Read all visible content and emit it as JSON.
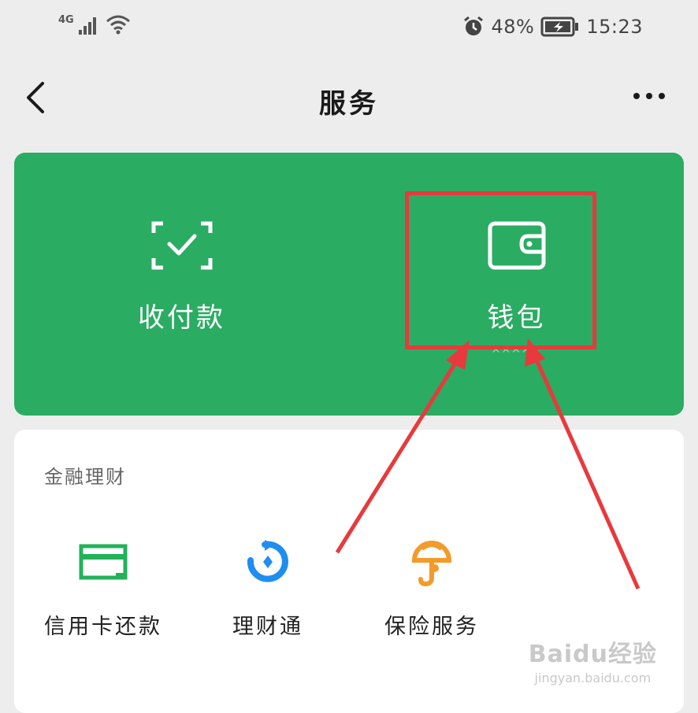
{
  "status_bar": {
    "network": "4G",
    "battery_percent": "48%",
    "time": "15:23"
  },
  "header": {
    "title": "服务"
  },
  "main_card": {
    "items": [
      {
        "label": "收付款",
        "icon": "scan-check-icon"
      },
      {
        "label": "钱包",
        "icon": "wallet-icon",
        "sub": "^^^^^"
      }
    ]
  },
  "finance_section": {
    "title": "金融理财",
    "items": [
      {
        "label": "信用卡还款",
        "icon": "credit-card-icon"
      },
      {
        "label": "理财通",
        "icon": "licaitong-icon"
      },
      {
        "label": "保险服务",
        "icon": "insurance-icon"
      }
    ]
  },
  "watermark": {
    "brand": "Baidu经验",
    "url": "jingyan.baidu.com"
  },
  "colors": {
    "green": "#2aac63",
    "highlight_red": "#e8393c",
    "background": "#ededed"
  }
}
